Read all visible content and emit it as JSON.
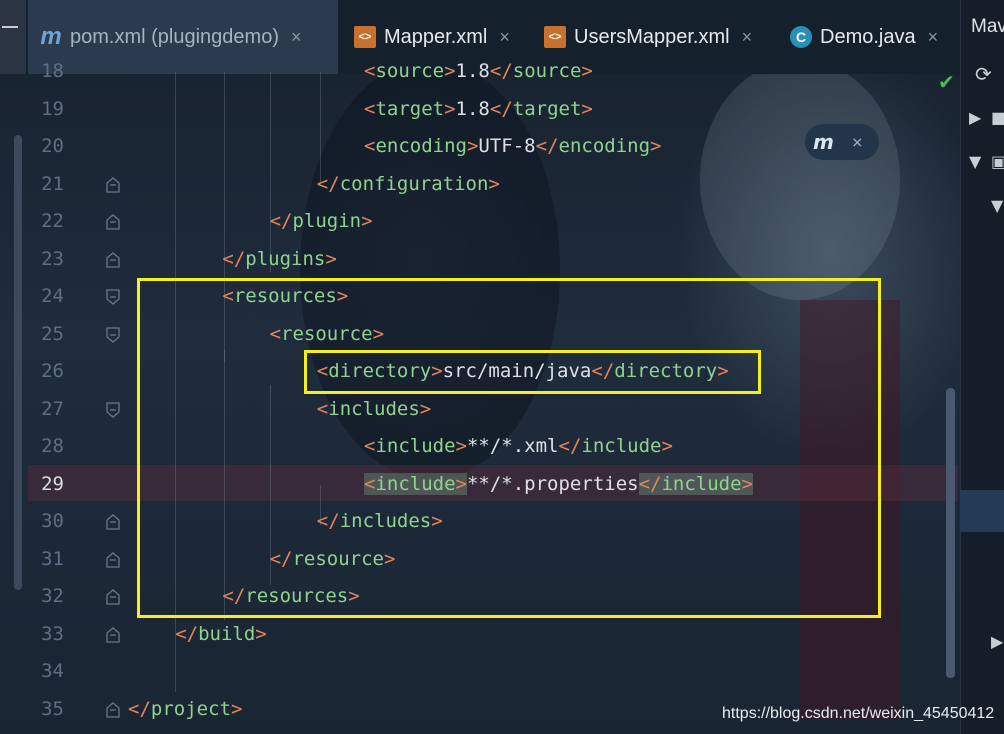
{
  "tabs": [
    {
      "label": "pom.xml (plugingdemo)",
      "icon": "maven-icon",
      "glyph": "m"
    },
    {
      "label": "Mapper.xml",
      "icon": "xml-file-icon",
      "glyph": "<>"
    },
    {
      "label": "UsersMapper.xml",
      "icon": "xml-file-icon",
      "glyph": "<>"
    },
    {
      "label": "Demo.java",
      "icon": "java-class-icon",
      "glyph": "C"
    }
  ],
  "tab_close": "×",
  "right_panel": {
    "title": "Mav",
    "refresh_icon": "refresh-icon"
  },
  "popup": {
    "icon": "maven-reload-icon",
    "glyph": "m",
    "close": "×"
  },
  "status_icon": "check-icon",
  "watermark": "https://blog.csdn.net/weixin_45450412",
  "current_line": 29,
  "lines": [
    {
      "n": "18",
      "indent": 10,
      "open": "source",
      "text": "1.8",
      "close": "source"
    },
    {
      "n": "19",
      "indent": 10,
      "open": "target",
      "text": "1.8",
      "close": "target"
    },
    {
      "n": "20",
      "indent": 10,
      "open": "encoding",
      "text": "UTF-8",
      "close": "encoding"
    },
    {
      "n": "21",
      "indent": 8,
      "end": "configuration"
    },
    {
      "n": "22",
      "indent": 6,
      "end": "plugin"
    },
    {
      "n": "23",
      "indent": 4,
      "end": "plugins"
    },
    {
      "n": "24",
      "indent": 4,
      "start": "resources"
    },
    {
      "n": "25",
      "indent": 6,
      "start": "resource"
    },
    {
      "n": "26",
      "indent": 8,
      "open": "directory",
      "text": "src/main/java",
      "close": "directory"
    },
    {
      "n": "27",
      "indent": 8,
      "start": "includes"
    },
    {
      "n": "28",
      "indent": 10,
      "open": "include",
      "text": "**/*.xml",
      "close": "include"
    },
    {
      "n": "29",
      "indent": 10,
      "open": "include",
      "text": "**/*.properties",
      "close": "include",
      "highlight": true
    },
    {
      "n": "30",
      "indent": 8,
      "end": "includes"
    },
    {
      "n": "31",
      "indent": 6,
      "end": "resource"
    },
    {
      "n": "32",
      "indent": 4,
      "end": "resources"
    },
    {
      "n": "33",
      "indent": 2,
      "end": "build"
    },
    {
      "n": "34",
      "indent": 0
    },
    {
      "n": "35",
      "indent": 0,
      "end": "project"
    }
  ]
}
